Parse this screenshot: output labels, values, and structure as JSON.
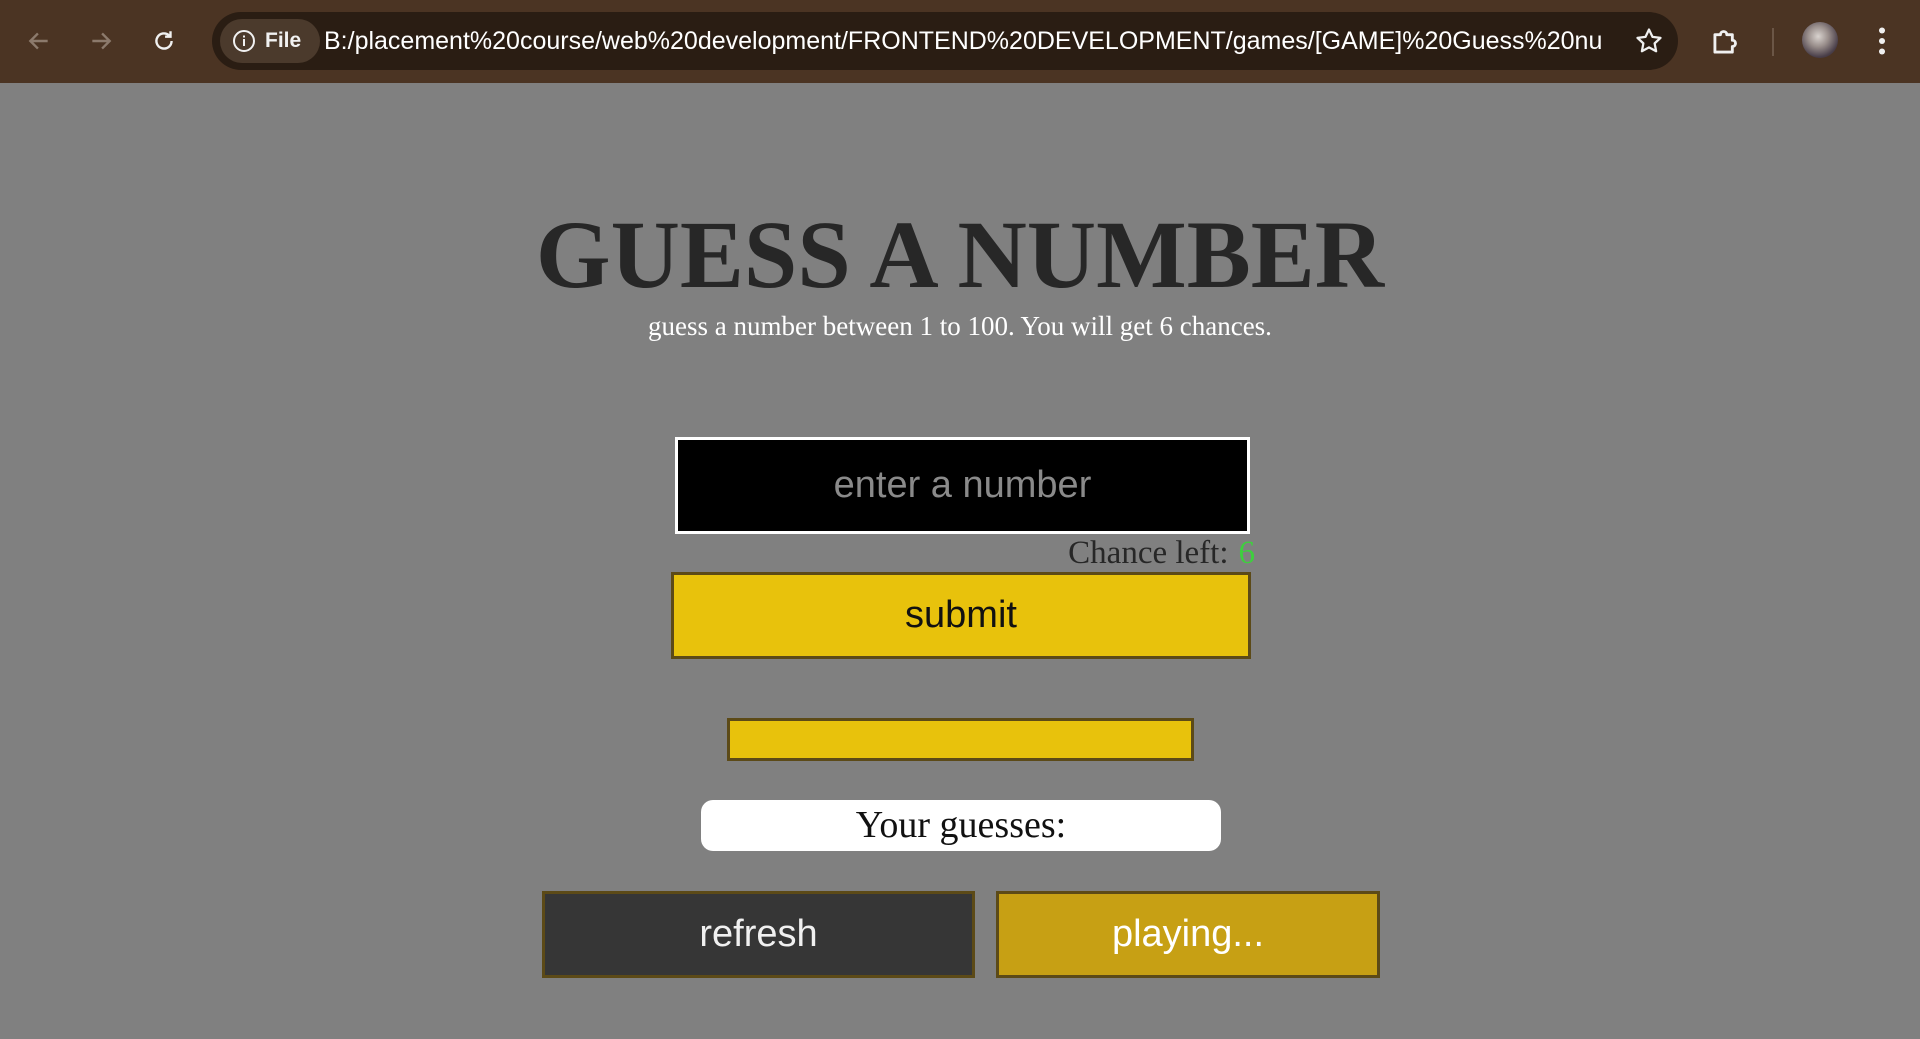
{
  "browser": {
    "url": "B:/placement%20course/web%20development/FRONTEND%20DEVELOPMENT/games/[GAME]%20Guess%20numbe...",
    "file_chip_label": "File",
    "icons": [
      "back-arrow-icon",
      "forward-arrow-icon",
      "reload-icon",
      "info-icon",
      "star-icon",
      "extensions-icon",
      "profile-avatar",
      "more-menu-icon"
    ]
  },
  "game": {
    "title": "GUESS A NUMBER",
    "subtitle": "guess a number between 1 to 100. You will get 6 chances.",
    "input_placeholder": "enter a number",
    "input_value": "",
    "chance_label": "Chance left:",
    "chance_value": "6",
    "submit_label": "submit",
    "result_text": "",
    "guesses_label": "Your guesses:",
    "refresh_label": "refresh",
    "status_label": "playing..."
  },
  "colors": {
    "page_bg": "#808080",
    "chrome_bg": "#4b3423",
    "accent_yellow": "#e8c20c",
    "chance_green": "#3ecf3e",
    "refresh_bg": "#363636"
  }
}
